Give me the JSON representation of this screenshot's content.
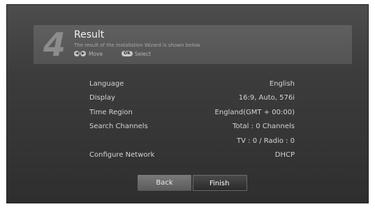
{
  "header": {
    "step_number": "4",
    "title": "Result",
    "subtitle": "The result of the Installation Wizard is shown below.",
    "hints": {
      "left_key_glyph": "◀",
      "right_key_glyph": "▶",
      "move_label": "Move",
      "ok_key_label": "OK",
      "select_label": "Select"
    }
  },
  "results": [
    {
      "label": "Language",
      "value": "English"
    },
    {
      "label": "Display",
      "value": "16:9, Auto, 576i"
    },
    {
      "label": "Time Region",
      "value": "England(GMT + 00:00)"
    },
    {
      "label": "Search Channels",
      "value": "Total : 0 Channels"
    },
    {
      "label": "",
      "value": "TV : 0 / Radio : 0"
    },
    {
      "label": "Configure Network",
      "value": "DHCP"
    }
  ],
  "buttons": {
    "back_label": "Back",
    "finish_label": "Finish"
  },
  "colors": {
    "background": "#3c3c3c",
    "panel": "#5a5a5a",
    "text": "#d4d4d4",
    "focused_button": "#2a2a2a"
  }
}
